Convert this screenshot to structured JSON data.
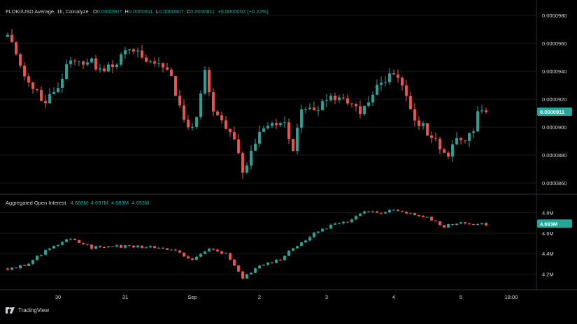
{
  "colors": {
    "up": "#26a69a",
    "down": "#ef5350",
    "bg": "#000000",
    "text": "#d1d4dc",
    "grid": "#1a1a1a",
    "divider": "#2a2e39"
  },
  "price_legend": {
    "title": "FLOKI/USD Average, 1h, Coinalyze",
    "o_label": "O",
    "o_value": "0.0000907",
    "h_label": "H",
    "h_value": "0.0000911",
    "l_label": "L",
    "l_value": "0.0000907",
    "c_label": "C",
    "c_value": "0.0000911",
    "change": "+0.0000002 (+0.22%)"
  },
  "oi_legend": {
    "title": "Aggregated Open Interest",
    "v1": "4.686M",
    "v2": "4.697M",
    "v3": "4.683M",
    "v4": "4.693M"
  },
  "brand": {
    "name": "TradingView",
    "icon": "tradingview-logo"
  },
  "chart_data": [
    {
      "type": "candlestick",
      "title": "FLOKI/USD Average, 1h, Coinalyze",
      "y_ticks": [
        "0.0000980",
        "0.0000960",
        "0.0000940",
        "0.0000920",
        "0.0000900",
        "0.0000880",
        "0.0000860"
      ],
      "y_tick_values": [
        9.8e-05,
        9.6e-05,
        9.4e-05,
        9.2e-05,
        9e-05,
        8.8e-05,
        8.6e-05
      ],
      "ylim": [
        8.53e-05,
        9.88e-05
      ],
      "last_price_label": "0.0000911",
      "last_price": 9.11e-05,
      "anchors": [
        [
          0,
          9.68e-05
        ],
        [
          3,
          9.42e-05
        ],
        [
          6,
          9.28e-05
        ],
        [
          9,
          9.18e-05
        ],
        [
          12,
          9.3e-05
        ],
        [
          15,
          9.48e-05
        ],
        [
          19,
          9.47e-05
        ],
        [
          23,
          9.42e-05
        ],
        [
          27,
          9.5e-05
        ],
        [
          30,
          9.55e-05
        ],
        [
          33,
          9.46e-05
        ],
        [
          36,
          9.45e-05
        ],
        [
          39,
          9.37e-05
        ],
        [
          41,
          9.15e-05
        ],
        [
          43,
          8.97e-05
        ],
        [
          45,
          9.08e-05
        ],
        [
          47,
          9.4e-05
        ],
        [
          49,
          9.1e-05
        ],
        [
          52,
          9e-05
        ],
        [
          54,
          8.88e-05
        ],
        [
          56,
          8.68e-05
        ],
        [
          58,
          8.82e-05
        ],
        [
          60,
          9e-05
        ],
        [
          63,
          9.05e-05
        ],
        [
          66,
          9.02e-05
        ],
        [
          68,
          8.85e-05
        ],
        [
          70,
          9.12e-05
        ],
        [
          73,
          9.12e-05
        ],
        [
          76,
          9.18e-05
        ],
        [
          79,
          9.22e-05
        ],
        [
          82,
          9.13e-05
        ],
        [
          85,
          9.12e-05
        ],
        [
          88,
          9.3e-05
        ],
        [
          91,
          9.36e-05
        ],
        [
          93,
          9.35e-05
        ],
        [
          95,
          9.25e-05
        ],
        [
          97,
          9.02e-05
        ],
        [
          99,
          9e-05
        ],
        [
          101,
          8.93e-05
        ],
        [
          103,
          8.85e-05
        ],
        [
          105,
          8.81e-05
        ],
        [
          107,
          8.91e-05
        ],
        [
          109,
          8.93e-05
        ],
        [
          111,
          8.97e-05
        ],
        [
          112,
          9.1e-05
        ],
        [
          114,
          9.11e-05
        ]
      ]
    },
    {
      "type": "candlestick",
      "title": "Aggregated Open Interest",
      "y_ticks": [
        "4.8M",
        "4.6M",
        "4.4M",
        "4.2M"
      ],
      "y_tick_values": [
        4.8,
        4.6,
        4.4,
        4.2
      ],
      "ylim": [
        4.08,
        4.9
      ],
      "last_value_label": "4.693M",
      "last_value": 4.693,
      "anchors": [
        [
          0,
          4.25
        ],
        [
          4,
          4.28
        ],
        [
          8,
          4.4
        ],
        [
          12,
          4.5
        ],
        [
          15,
          4.54
        ],
        [
          20,
          4.46
        ],
        [
          25,
          4.47
        ],
        [
          30,
          4.47
        ],
        [
          35,
          4.46
        ],
        [
          40,
          4.44
        ],
        [
          44,
          4.33
        ],
        [
          48,
          4.44
        ],
        [
          52,
          4.4
        ],
        [
          56,
          4.16
        ],
        [
          60,
          4.28
        ],
        [
          65,
          4.35
        ],
        [
          69,
          4.48
        ],
        [
          73,
          4.6
        ],
        [
          77,
          4.67
        ],
        [
          81,
          4.72
        ],
        [
          84,
          4.8
        ],
        [
          88,
          4.8
        ],
        [
          92,
          4.82
        ],
        [
          96,
          4.8
        ],
        [
          100,
          4.75
        ],
        [
          104,
          4.67
        ],
        [
          108,
          4.7
        ],
        [
          112,
          4.69
        ],
        [
          114,
          4.69
        ]
      ]
    }
  ],
  "x_axis": {
    "ticks": [
      {
        "label": "30",
        "index": 12
      },
      {
        "label": "31",
        "index": 28
      },
      {
        "label": "Sep",
        "index": 44
      },
      {
        "label": "2",
        "index": 60
      },
      {
        "label": "3",
        "index": 76
      },
      {
        "label": "4",
        "index": 92
      },
      {
        "label": "5",
        "index": 108
      },
      {
        "label": "18:00",
        "index": 120
      }
    ]
  }
}
